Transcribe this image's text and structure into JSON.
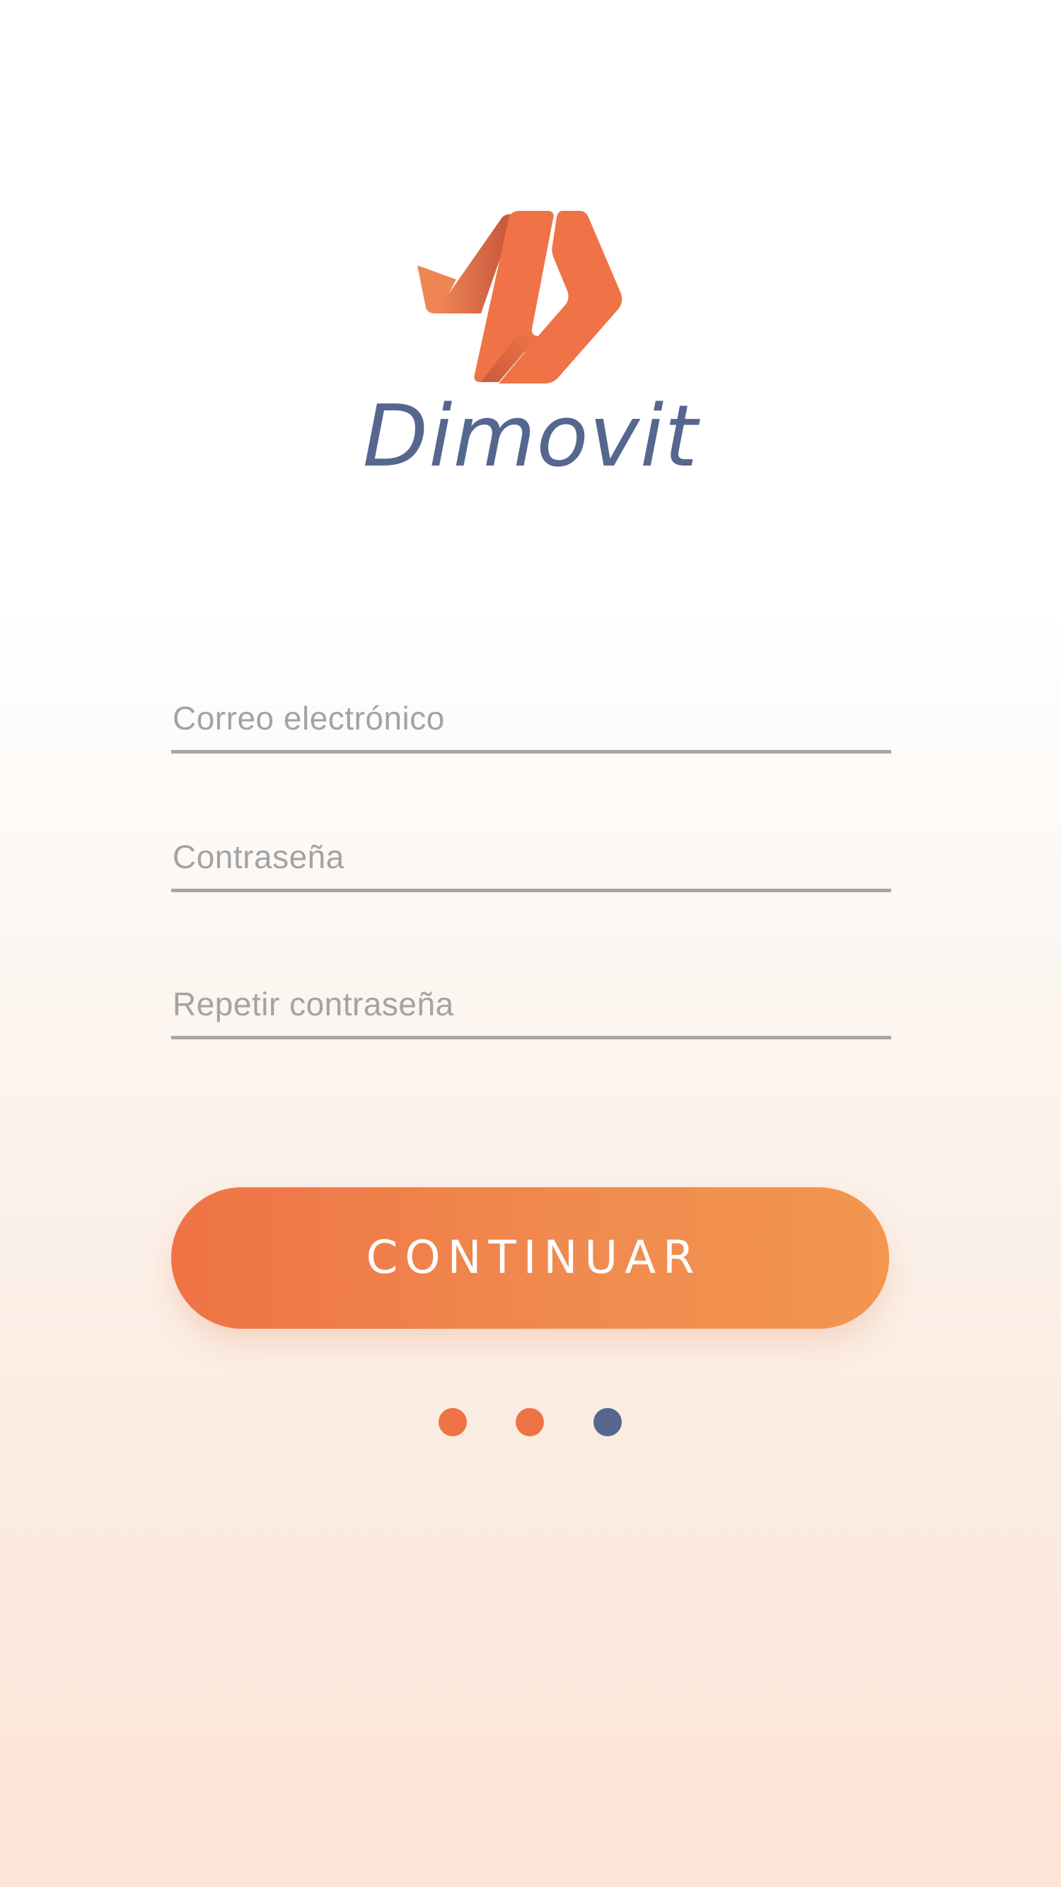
{
  "brand": {
    "name": "Dimovit",
    "logo_color": "#ef7346",
    "name_color": "#56678f"
  },
  "form": {
    "email": {
      "placeholder": "Correo electrónico",
      "value": ""
    },
    "password": {
      "placeholder": "Contraseña",
      "value": ""
    },
    "repeat_password": {
      "placeholder": "Repetir contraseña",
      "value": ""
    }
  },
  "continue_button": {
    "label": "CONTINUAR",
    "gradient_start": "#ef7346",
    "gradient_end": "#f3964f"
  },
  "pagination": {
    "total": 3,
    "current": 3,
    "dots": [
      {
        "color": "#ef7346",
        "active": false
      },
      {
        "color": "#ef7346",
        "active": false
      },
      {
        "color": "#56678f",
        "active": true
      }
    ]
  }
}
